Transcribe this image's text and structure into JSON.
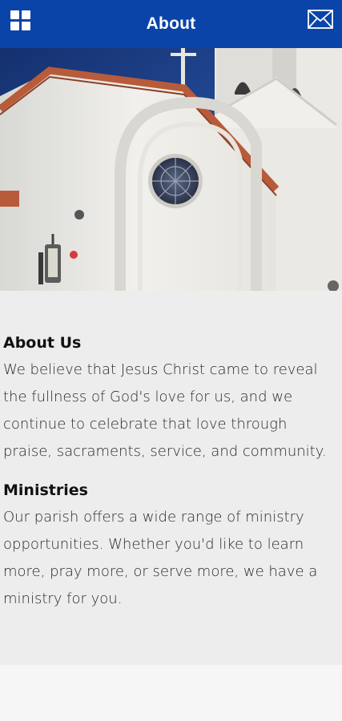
{
  "theme": {
    "brand": "#0a44a8"
  },
  "header": {
    "title": "About",
    "menu_icon": "grid-menu-icon",
    "mail_icon": "envelope-icon"
  },
  "hero": {
    "image": "church-exterior-photo"
  },
  "sections": [
    {
      "title": "About Us",
      "body": "We believe that Jesus Christ came to reveal the fullness of God's love for us, and we continue to celebrate that love through praise, sacraments, service, and community."
    },
    {
      "title": "Ministries",
      "body": "Our parish offers a wide range of ministry opportunities. Whether you'd like to learn more, pray more, or serve more, we have a ministry for you."
    }
  ]
}
